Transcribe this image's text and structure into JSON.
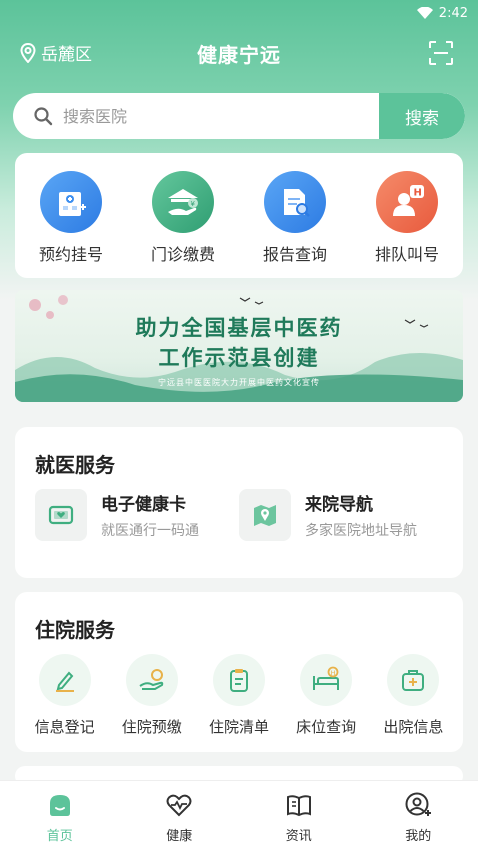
{
  "status": {
    "time": "2:42"
  },
  "header": {
    "location": "岳麓区",
    "title": "健康宁远"
  },
  "search": {
    "placeholder": "搜索医院",
    "button": "搜索"
  },
  "quick_actions": [
    {
      "label": "预约挂号",
      "icon": "hospital-icon",
      "color": "#3d8ff0"
    },
    {
      "label": "门诊缴费",
      "icon": "payment-icon",
      "color": "#3fae80"
    },
    {
      "label": "报告查询",
      "icon": "report-search-icon",
      "color": "#3d8ff0"
    },
    {
      "label": "排队叫号",
      "icon": "queue-icon",
      "color": "#f06a4c"
    }
  ],
  "banner": {
    "line1": "助力全国基层中医药",
    "line2": "工作示范县创建",
    "line3": "宁远县中医医院大力开展中医药文化宣传"
  },
  "medical_services": {
    "title": "就医服务",
    "items": [
      {
        "name": "电子健康卡",
        "desc": "就医通行一码通",
        "icon": "health-card-icon"
      },
      {
        "name": "来院导航",
        "desc": "多家医院地址导航",
        "icon": "map-nav-icon"
      }
    ]
  },
  "hospital_services": {
    "title": "住院服务",
    "items": [
      {
        "label": "信息登记",
        "icon": "pencil-icon"
      },
      {
        "label": "住院预缴",
        "icon": "prepay-icon"
      },
      {
        "label": "住院清单",
        "icon": "clipboard-icon"
      },
      {
        "label": "床位查询",
        "icon": "bed-icon"
      },
      {
        "label": "出院信息",
        "icon": "medkit-icon"
      }
    ]
  },
  "tabbar": [
    {
      "label": "首页",
      "active": true
    },
    {
      "label": "健康",
      "active": false
    },
    {
      "label": "资讯",
      "active": false
    },
    {
      "label": "我的",
      "active": false
    }
  ],
  "colors": {
    "accent": "#5cc39a",
    "bg": "#f2f4f3"
  }
}
